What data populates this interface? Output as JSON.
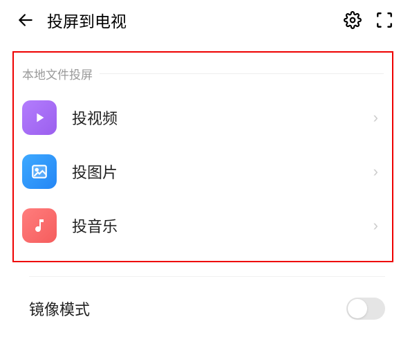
{
  "header": {
    "title": "投屏到电视"
  },
  "section": {
    "title": "本地文件投屏",
    "items": [
      {
        "label": "投视频",
        "icon": "video"
      },
      {
        "label": "投图片",
        "icon": "image"
      },
      {
        "label": "投音乐",
        "icon": "music"
      }
    ]
  },
  "mirror": {
    "label": "镜像模式",
    "enabled": false
  }
}
